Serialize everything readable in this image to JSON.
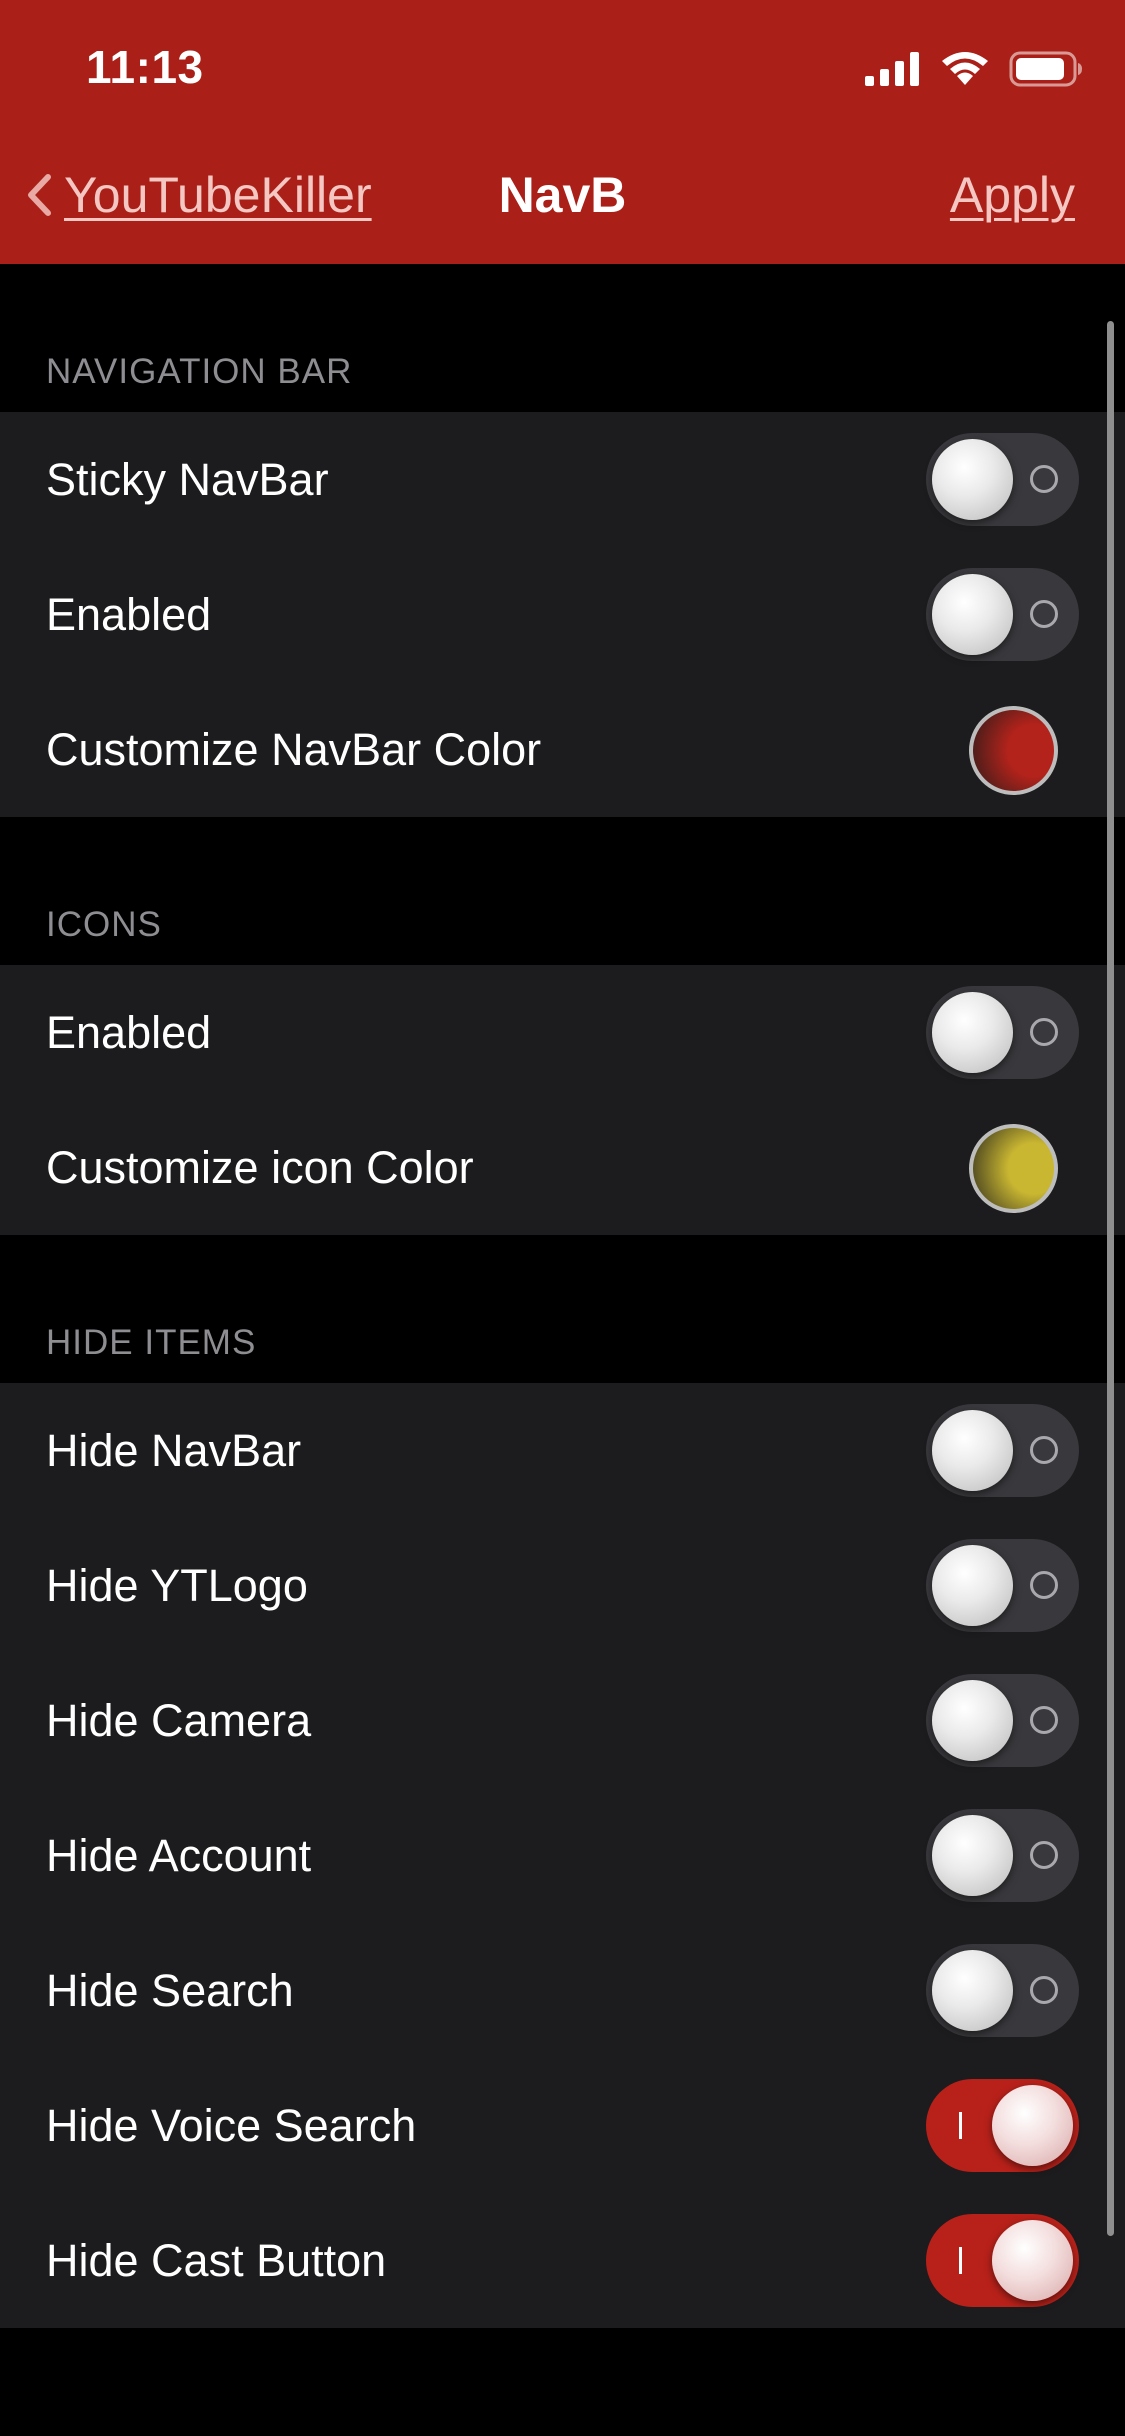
{
  "status_bar": {
    "time": "11:13",
    "icons": [
      "signal-icon",
      "wifi-icon",
      "battery-icon"
    ]
  },
  "nav": {
    "back_label": "YouTubeKiller",
    "title": "NavB",
    "apply_label": "Apply"
  },
  "colors": {
    "accent": "#aa2018",
    "background": "#000000",
    "cell": "#1c1c1e",
    "toggle_off": "#39393d",
    "toggle_on": "#b8211a",
    "section_header_text": "#8d8d92"
  },
  "sections": [
    {
      "header": "NAVIGATION BAR",
      "rows": [
        {
          "label": "Sticky NavBar",
          "type": "toggle",
          "on": false
        },
        {
          "label": "Enabled",
          "type": "toggle",
          "on": false
        },
        {
          "label": "Customize NavBar Color",
          "type": "color",
          "color": "#b3231b"
        }
      ]
    },
    {
      "header": "ICONS",
      "rows": [
        {
          "label": "Enabled",
          "type": "toggle",
          "on": false
        },
        {
          "label": "Customize icon Color",
          "type": "color",
          "color": "#c9b631"
        }
      ]
    },
    {
      "header": "HIDE ITEMS",
      "rows": [
        {
          "label": "Hide NavBar",
          "type": "toggle",
          "on": false
        },
        {
          "label": "Hide YTLogo",
          "type": "toggle",
          "on": false
        },
        {
          "label": "Hide Camera",
          "type": "toggle",
          "on": false
        },
        {
          "label": "Hide Account",
          "type": "toggle",
          "on": false
        },
        {
          "label": "Hide Search",
          "type": "toggle",
          "on": false
        },
        {
          "label": "Hide Voice Search",
          "type": "toggle",
          "on": true
        },
        {
          "label": "Hide Cast Button",
          "type": "toggle",
          "on": true
        }
      ]
    }
  ]
}
